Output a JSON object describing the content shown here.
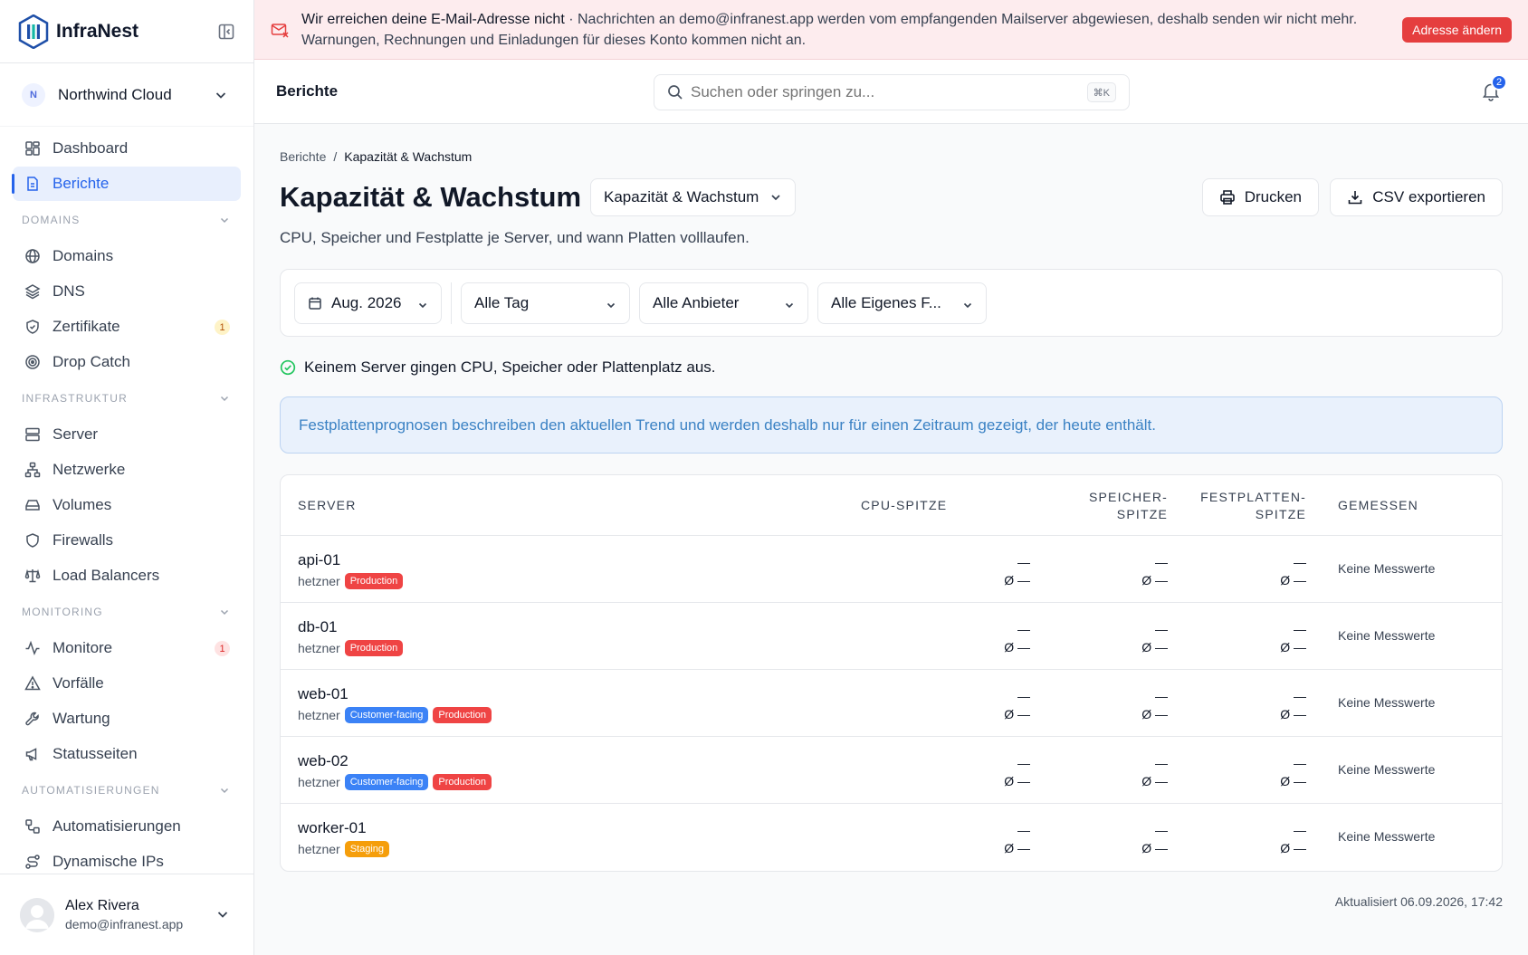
{
  "brand": {
    "name": "InfraNest"
  },
  "workspace": {
    "initial": "N",
    "name": "Northwind Cloud"
  },
  "nav": {
    "dashboard": "Dashboard",
    "reports": "Berichte",
    "sections": {
      "domains": "DOMAINS",
      "infra": "INFRASTRUKTUR",
      "monitoring": "MONITORING",
      "automation": "AUTOMATISIERUNGEN"
    },
    "domains": "Domains",
    "dns": "DNS",
    "certs": "Zertifikate",
    "certs_badge": "1",
    "dropcatch": "Drop Catch",
    "server": "Server",
    "networks": "Netzwerke",
    "volumes": "Volumes",
    "firewalls": "Firewalls",
    "loadbalancers": "Load Balancers",
    "monitors": "Monitore",
    "monitors_badge": "1",
    "incidents": "Vorfälle",
    "maintenance": "Wartung",
    "statuspages": "Statusseiten",
    "automations": "Automatisierungen",
    "dynips": "Dynamische IPs"
  },
  "user": {
    "name": "Alex Rivera",
    "email": "demo@infranest.app"
  },
  "alert": {
    "title": "Wir erreichen deine E-Mail-Adresse nicht",
    "body": " · Nachrichten an demo@infranest.app werden vom empfangenden Mailserver abgewiesen, deshalb senden wir nicht mehr. Warnungen, Rechnungen und Einladungen für dieses Konto kommen nicht an.",
    "button": "Adresse ändern"
  },
  "topbar": {
    "title": "Berichte",
    "search_placeholder": "Suchen oder springen zu...",
    "shortcut": "⌘K",
    "notif_count": "2"
  },
  "breadcrumb": {
    "root": "Berichte",
    "sep": "/",
    "current": "Kapazität & Wachstum"
  },
  "page": {
    "title": "Kapazität & Wachstum",
    "report_select": "Kapazität & Wachstum",
    "subtitle": "CPU, Speicher und Festplatte je Server, und wann Platten volllaufen.",
    "print": "Drucken",
    "csv": "CSV exportieren"
  },
  "filters": {
    "month": "Aug. 2026",
    "tag": "Alle Tag",
    "provider": "Alle Anbieter",
    "custom": "Alle Eigenes F..."
  },
  "status_ok": "Keinem Server gingen CPU, Speicher oder Plattenplatz aus.",
  "info": "Festplattenprognosen beschreiben den aktuellen Trend und werden deshalb nur für einen Zeitraum gezeigt, der heute enthält.",
  "table": {
    "headers": {
      "server": "SERVER",
      "cpu": "CPU-SPITZE",
      "mem_1": "SPEICHER-",
      "mem_2": "SPITZE",
      "disk_1": "FESTPLATTEN-",
      "disk_2": "SPITZE",
      "measured": "GEMESSEN"
    },
    "peak": "—",
    "avg": "Ø —",
    "no_data": "Keine Messwerte",
    "rows": [
      {
        "name": "api-01",
        "provider": "hetzner",
        "tags": [
          "Production"
        ]
      },
      {
        "name": "db-01",
        "provider": "hetzner",
        "tags": [
          "Production"
        ]
      },
      {
        "name": "web-01",
        "provider": "hetzner",
        "tags": [
          "Customer-facing",
          "Production"
        ]
      },
      {
        "name": "web-02",
        "provider": "hetzner",
        "tags": [
          "Customer-facing",
          "Production"
        ]
      },
      {
        "name": "worker-01",
        "provider": "hetzner",
        "tags": [
          "Staging"
        ]
      }
    ]
  },
  "updated": "Aktualisiert 06.09.2026, 17:42",
  "colors": {
    "accent": "#2563eb",
    "danger": "#ef4444",
    "warning": "#f59e0b",
    "success": "#22c55e"
  }
}
